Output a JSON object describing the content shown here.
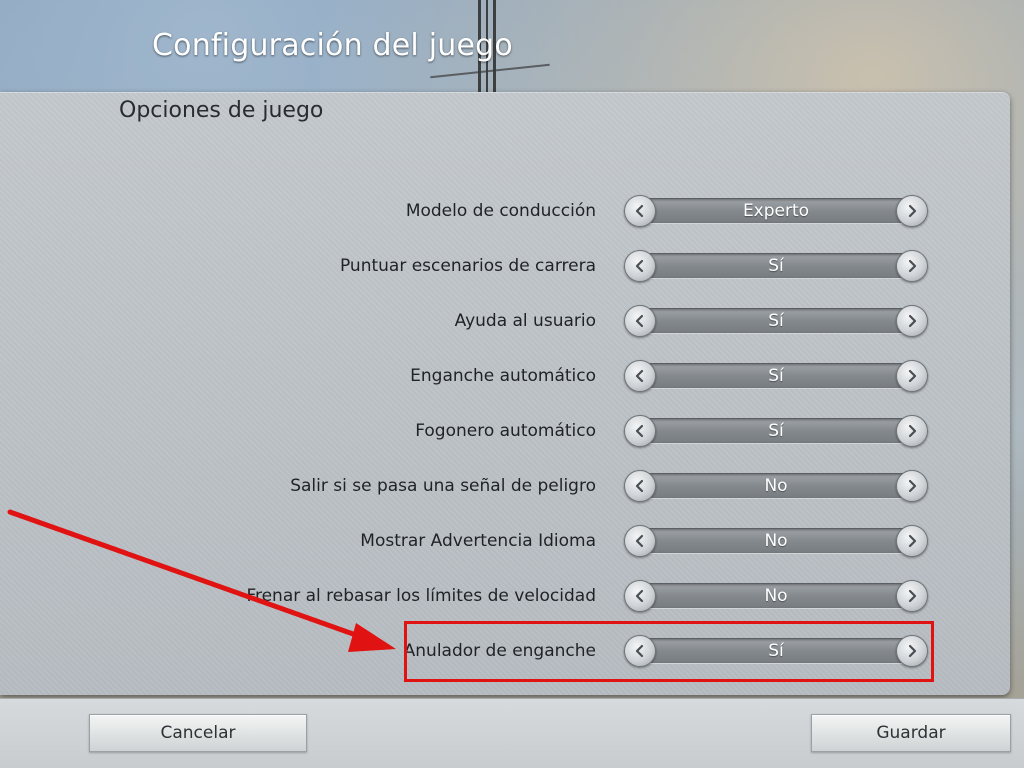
{
  "window": {
    "title": "Configuración del juego"
  },
  "section": {
    "title": "Opciones de juego"
  },
  "options": [
    {
      "label": "Modelo de conducción",
      "value": "Experto"
    },
    {
      "label": "Puntuar escenarios de carrera",
      "value": "Sí"
    },
    {
      "label": "Ayuda al usuario",
      "value": "Sí"
    },
    {
      "label": "Enganche automático",
      "value": "Sí"
    },
    {
      "label": "Fogonero automático",
      "value": "Sí"
    },
    {
      "label": "Salir si se pasa una señal de peligro",
      "value": "No"
    },
    {
      "label": "Mostrar Advertencia Idioma",
      "value": "No"
    },
    {
      "label": "Frenar al rebasar los límites de velocidad",
      "value": "No"
    },
    {
      "label": "Anulador de enganche",
      "value": "Sí"
    }
  ],
  "highlighted_option": "Anulador de enganche",
  "annotation": {
    "arrow_color": "#e01212",
    "box_color": "#e01212"
  },
  "footer": {
    "cancel_label": "Cancelar",
    "save_label": "Guardar"
  },
  "icons": {
    "left": "chevron-left-icon",
    "right": "chevron-right-icon"
  }
}
